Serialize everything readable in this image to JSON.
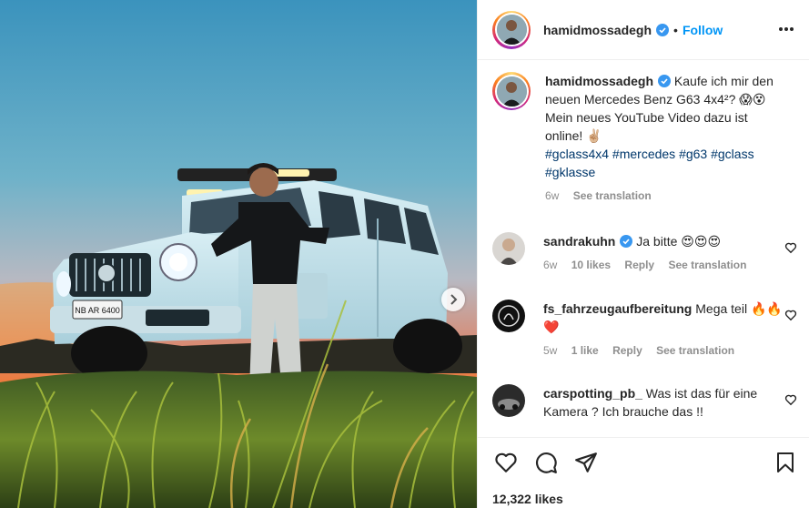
{
  "post": {
    "username": "hamidmossadegh",
    "follow_label": "Follow",
    "separator": "•",
    "caption_text": "Kaufe ich mir den neuen Mercedes Benz G63 4x4²? 😱😵 Mein neues YouTube Video dazu ist online! ✌🏼",
    "hashtags": "#gclass4x4 #mercedes #g63 #gclass #gklasse",
    "caption_age": "6w",
    "see_translation": "See translation",
    "license_plate": "NB AR 6400",
    "likes": "12,322 likes"
  },
  "comments": [
    {
      "username": "sandrakuhn",
      "verified": true,
      "text": "Ja bitte 😍😍😍",
      "age": "6w",
      "likes": "10 likes",
      "reply": "Reply",
      "translate": "See translation"
    },
    {
      "username": "fs_fahrzeugaufbereitung",
      "verified": false,
      "text": "Mega teil 🔥🔥❤️",
      "age": "5w",
      "likes": "1 like",
      "reply": "Reply",
      "translate": "See translation"
    },
    {
      "username": "carspotting_pb_",
      "verified": false,
      "text": "Was ist das für eine Kamera ? Ich brauche das !!",
      "age": "",
      "likes": "",
      "reply": "",
      "translate": ""
    }
  ],
  "icons": {
    "verified": "verified-badge-icon",
    "more": "more-options-icon",
    "like": "heart-icon",
    "comment": "comment-icon",
    "share": "paper-plane-icon",
    "save": "bookmark-icon",
    "next": "chevron-right-icon"
  },
  "colors": {
    "accent": "#0095f6",
    "text": "#262626",
    "muted": "#8e8e8e",
    "hashtag": "#00376b",
    "verified": "#3897f0"
  }
}
